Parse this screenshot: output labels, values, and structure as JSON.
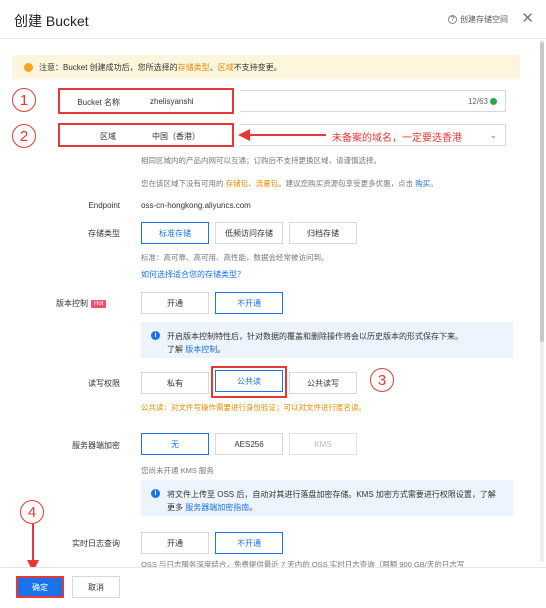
{
  "header": {
    "title": "创建 Bucket",
    "help_label": "创建存储空间",
    "help_icon": "question-circle-icon",
    "close_icon": "close-icon"
  },
  "notice": {
    "prefix": "注意：Bucket 创建成功后，您所选择的 ",
    "link1": "存储类型",
    "sep": "、",
    "link2": "区域",
    "suffix": " 不支持变更。"
  },
  "bucket_name": {
    "label": "Bucket 名称",
    "value": "zhelisyanshi",
    "counter": "12/63"
  },
  "region": {
    "label": "区域",
    "value": "中国（香港）",
    "annotation": "未备案的域名，一定要选香港",
    "hint1": "相同区域内的产品内网可以互通；订购后不支持更换区域，请谨慎选择。",
    "hint2_prefix": "您在该区域下没有可用的 ",
    "hint2_link1": "存储包",
    "hint2_sep": "、",
    "hint2_link2": "流量包",
    "hint2_mid": "。建议您购买资源包享受更多优惠，点击 ",
    "hint2_link3": "购买",
    "hint2_suffix": "。"
  },
  "endpoint": {
    "label": "Endpoint",
    "value": "oss-cn-hongkong.aliyuncs.com"
  },
  "storage_class": {
    "label": "存储类型",
    "options": [
      "标准存储",
      "低频访问存储",
      "归档存储"
    ],
    "hint": "标准：高可靠、高可用、高性能，数据会经常被访问到。",
    "link": "如何选择适合您的存储类型？"
  },
  "versioning": {
    "label": "版本控制",
    "badge": "Hot",
    "options": [
      "开通",
      "不开通"
    ],
    "info": "开启版本控制特性后，针对数据的覆盖和删除操作将会以历史版本的形式保存下来。",
    "info_link_prefix": "了解 ",
    "info_link": "版本控制",
    "info_suffix": "。"
  },
  "acl": {
    "label": "读写权限",
    "options": [
      "私有",
      "公共读",
      "公共读写"
    ],
    "warning": "公共读：对文件写操作需要进行身份验证；可以对文件进行匿名读。"
  },
  "encryption": {
    "label": "服务器端加密",
    "options": [
      "无",
      "AES256",
      "KMS"
    ],
    "hint": "您尚未开通 KMS 服务",
    "info": "将文件上传至 OSS 后，自动对其进行落盘加密存储。KMS 加密方式需要进行权限设置，了解更多 ",
    "info_link": "服务器端加密指南",
    "info_suffix": "。"
  },
  "realtime_log": {
    "label": "实时日志查询",
    "options": [
      "开通",
      "不开通"
    ],
    "hint": "OSS 与日志服务深度结合，免费提供最近 7 天内的 OSS 实时日志查询（限额 900 GB/天的日志写"
  },
  "markers": [
    "1",
    "2",
    "3",
    "4"
  ],
  "footer": {
    "confirm": "确定",
    "cancel": "取消"
  },
  "colors": {
    "accent": "#1a73e8",
    "annotation": "#e53935",
    "warning": "#e88b00"
  }
}
